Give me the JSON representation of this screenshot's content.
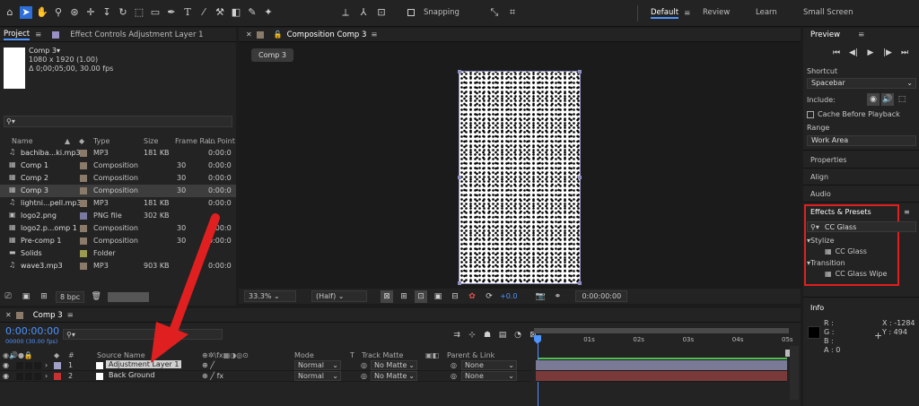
{
  "toolbar": {
    "snapping": "Snapping",
    "workspaces": [
      "Default",
      "Review",
      "Learn",
      "Small Screen"
    ],
    "default_menu": "≡"
  },
  "project": {
    "tab": "Project",
    "tab_menu": "≡",
    "effect_controls_tab": "Effect Controls Adjustment Layer 1",
    "preview_title": "Comp 3▾",
    "preview_res": "1080 x 1920 (1.00)",
    "preview_dur": "Δ 0;00;05;00, 30.00 fps",
    "search_placeholder": "",
    "columns": [
      "Name",
      "Type",
      "Size",
      "Frame Ra...",
      "In Point"
    ],
    "items": [
      {
        "name": "bachiba...ki.mp3",
        "type": "MP3",
        "size": "181 KB",
        "fr": "",
        "in": "0:00:0",
        "icon": "audio-icon",
        "color": "#8a7a6a"
      },
      {
        "name": "Comp 1",
        "type": "Composition",
        "size": "",
        "fr": "30",
        "in": "0:00:0",
        "icon": "composition-icon",
        "color": "#8a7a6a"
      },
      {
        "name": "Comp 2",
        "type": "Composition",
        "size": "",
        "fr": "30",
        "in": "0:00:0",
        "icon": "composition-icon",
        "color": "#8a7a6a"
      },
      {
        "name": "Comp 3",
        "type": "Composition",
        "size": "",
        "fr": "30",
        "in": "0:00:0",
        "icon": "composition-icon",
        "color": "#8a7a6a",
        "selected": true
      },
      {
        "name": "lightni...pell.mp3",
        "type": "MP3",
        "size": "181 KB",
        "fr": "",
        "in": "0:00:0",
        "icon": "audio-icon",
        "color": "#8a7a6a"
      },
      {
        "name": "logo2.png",
        "type": "PNG file",
        "size": "302 KB",
        "fr": "",
        "in": "",
        "icon": "image-icon",
        "color": "#7a7aa0"
      },
      {
        "name": "logo2.p...omp 1",
        "type": "Composition",
        "size": "",
        "fr": "30",
        "in": "0:00:0",
        "icon": "composition-icon",
        "color": "#8a7a6a"
      },
      {
        "name": "Pre-comp 1",
        "type": "Composition",
        "size": "",
        "fr": "30",
        "in": "0:00:0",
        "icon": "composition-icon",
        "color": "#8a7a6a"
      },
      {
        "name": "Solids",
        "type": "Folder",
        "size": "",
        "fr": "",
        "in": "",
        "icon": "folder-icon",
        "color": "#9a9a50"
      },
      {
        "name": "wave3.mp3",
        "type": "MP3",
        "size": "903 KB",
        "fr": "",
        "in": "0:00:0",
        "icon": "audio-icon",
        "color": "#8a7a6a"
      }
    ],
    "bpc": "8 bpc"
  },
  "comp": {
    "tab": "Composition Comp 3",
    "tab_menu": "≡",
    "breadcrumb": "Comp 3",
    "zoom": "33.3%",
    "quality": "(Half)",
    "exposure": "+0.0",
    "timecode": "0:00:00:00"
  },
  "right": {
    "preview": "Preview",
    "preview_menu": "≡",
    "shortcut_label": "Shortcut",
    "shortcut_value": "Spacebar",
    "include_label": "Include:",
    "cache": "Cache Before Playback",
    "range_label": "Range",
    "range_value": "Work Area",
    "properties": "Properties",
    "align": "Align",
    "audio": "Audio",
    "effects_title": "Effects & Presets",
    "effects_menu": "≡",
    "effects_search": "CC Glass",
    "groups": [
      {
        "name": "Stylize",
        "item": "CC Glass"
      },
      {
        "name": "Transition",
        "item": "CC Glass Wipe"
      }
    ],
    "info": "Info",
    "info_r": "R :",
    "info_g": "G :",
    "info_b": "B :",
    "info_a": "A :  0",
    "info_x": "X :  -1284",
    "info_y": "Y :  494"
  },
  "timeline": {
    "tab": "Comp 3",
    "tab_menu": "≡",
    "timecode": "0:00:00:00",
    "fps": "00000 (30.00 fps)",
    "headers": {
      "hash": "#",
      "source": "Source Name",
      "mode": "Mode",
      "t": "T",
      "track": "Track Matte",
      "parent": "Parent & Link"
    },
    "ruler": [
      "0s",
      "01s",
      "02s",
      "03s",
      "04s",
      "05s"
    ],
    "layers": [
      {
        "num": "1",
        "name": "Adjustment Layer 1",
        "mode": "Normal",
        "matte": "No Matte",
        "parent": "None",
        "color": "#a0a0c8",
        "bar": "#7a7a96"
      },
      {
        "num": "2",
        "name": "Back Ground",
        "mode": "Normal",
        "matte": "No Matte",
        "parent": "None",
        "color": "#c83232",
        "bar": "#7a3a3a"
      }
    ]
  },
  "colors": {
    "accent": "#4d94ff",
    "highlight": "#e02020"
  }
}
